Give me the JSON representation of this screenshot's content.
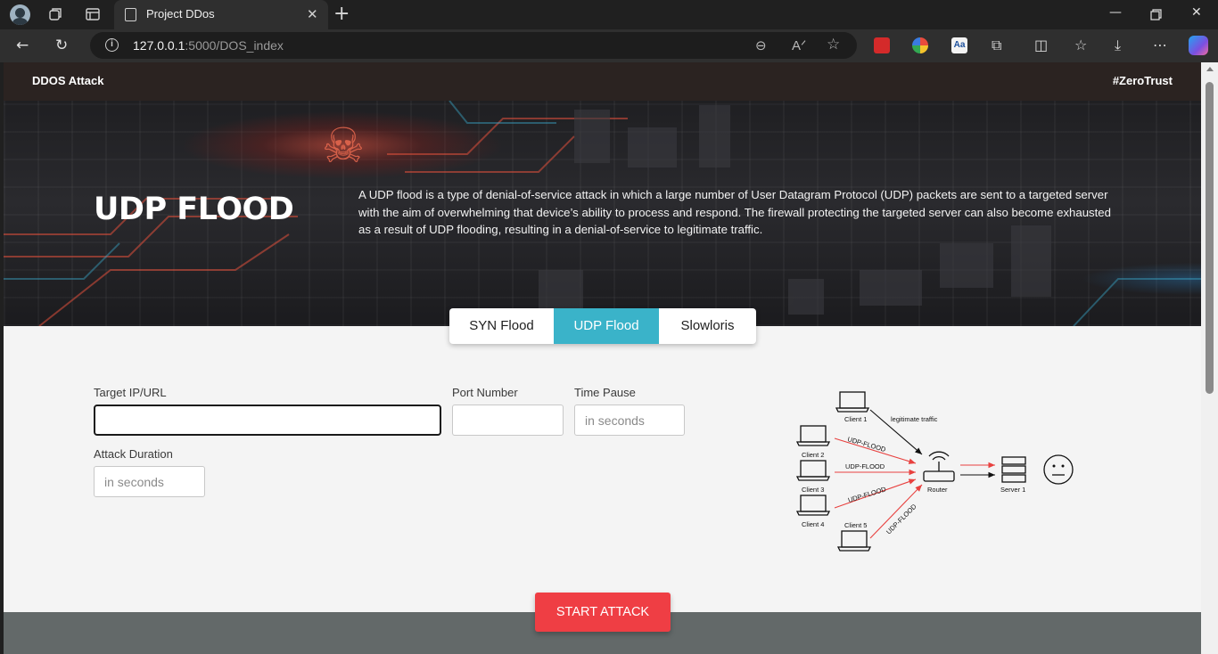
{
  "browser": {
    "tab_title": "Project DDos",
    "url_host": "127.0.0.1",
    "url_path": ":5000/DOS_index",
    "reader_icon_label": "A",
    "ext_label": "Aa"
  },
  "navbar": {
    "brand": "DDOS Attack",
    "hashtag": "#ZeroTrust"
  },
  "hero": {
    "title": "UDP FLOOD",
    "description": "A UDP flood is a type of denial-of-service attack in which a large number of User Datagram Protocol (UDP) packets are sent to a targeted server with the aim of overwhelming that device’s ability to process and respond. The firewall protecting the targeted server can also become exhausted as a result of UDP flooding, resulting in a denial-of-service to legitimate traffic."
  },
  "attack_tabs": [
    {
      "label": "SYN Flood",
      "active": false
    },
    {
      "label": "UDP Flood",
      "active": true
    },
    {
      "label": "Slowloris",
      "active": false
    }
  ],
  "form": {
    "target": {
      "label": "Target IP/URL",
      "value": "",
      "placeholder": ""
    },
    "port": {
      "label": "Port Number",
      "value": "",
      "placeholder": ""
    },
    "time_pause": {
      "label": "Time Pause",
      "value": "",
      "placeholder": "in seconds"
    },
    "duration": {
      "label": "Attack Duration",
      "value": "",
      "placeholder": "in seconds"
    }
  },
  "diagram": {
    "clients": [
      "Client 1",
      "Client 2",
      "Client 3",
      "Client 4",
      "Client 5"
    ],
    "legit_label": "legitimate traffic",
    "flood_label": "UDP-FLOOD",
    "router_label": "Router",
    "server_label": "Server 1"
  },
  "start_button": "START ATTACK",
  "colors": {
    "accent_tab": "#3ab3c9",
    "start_button": "#ef3e44",
    "navbar": "#2b2321",
    "flood_arrow": "#e8413f"
  }
}
